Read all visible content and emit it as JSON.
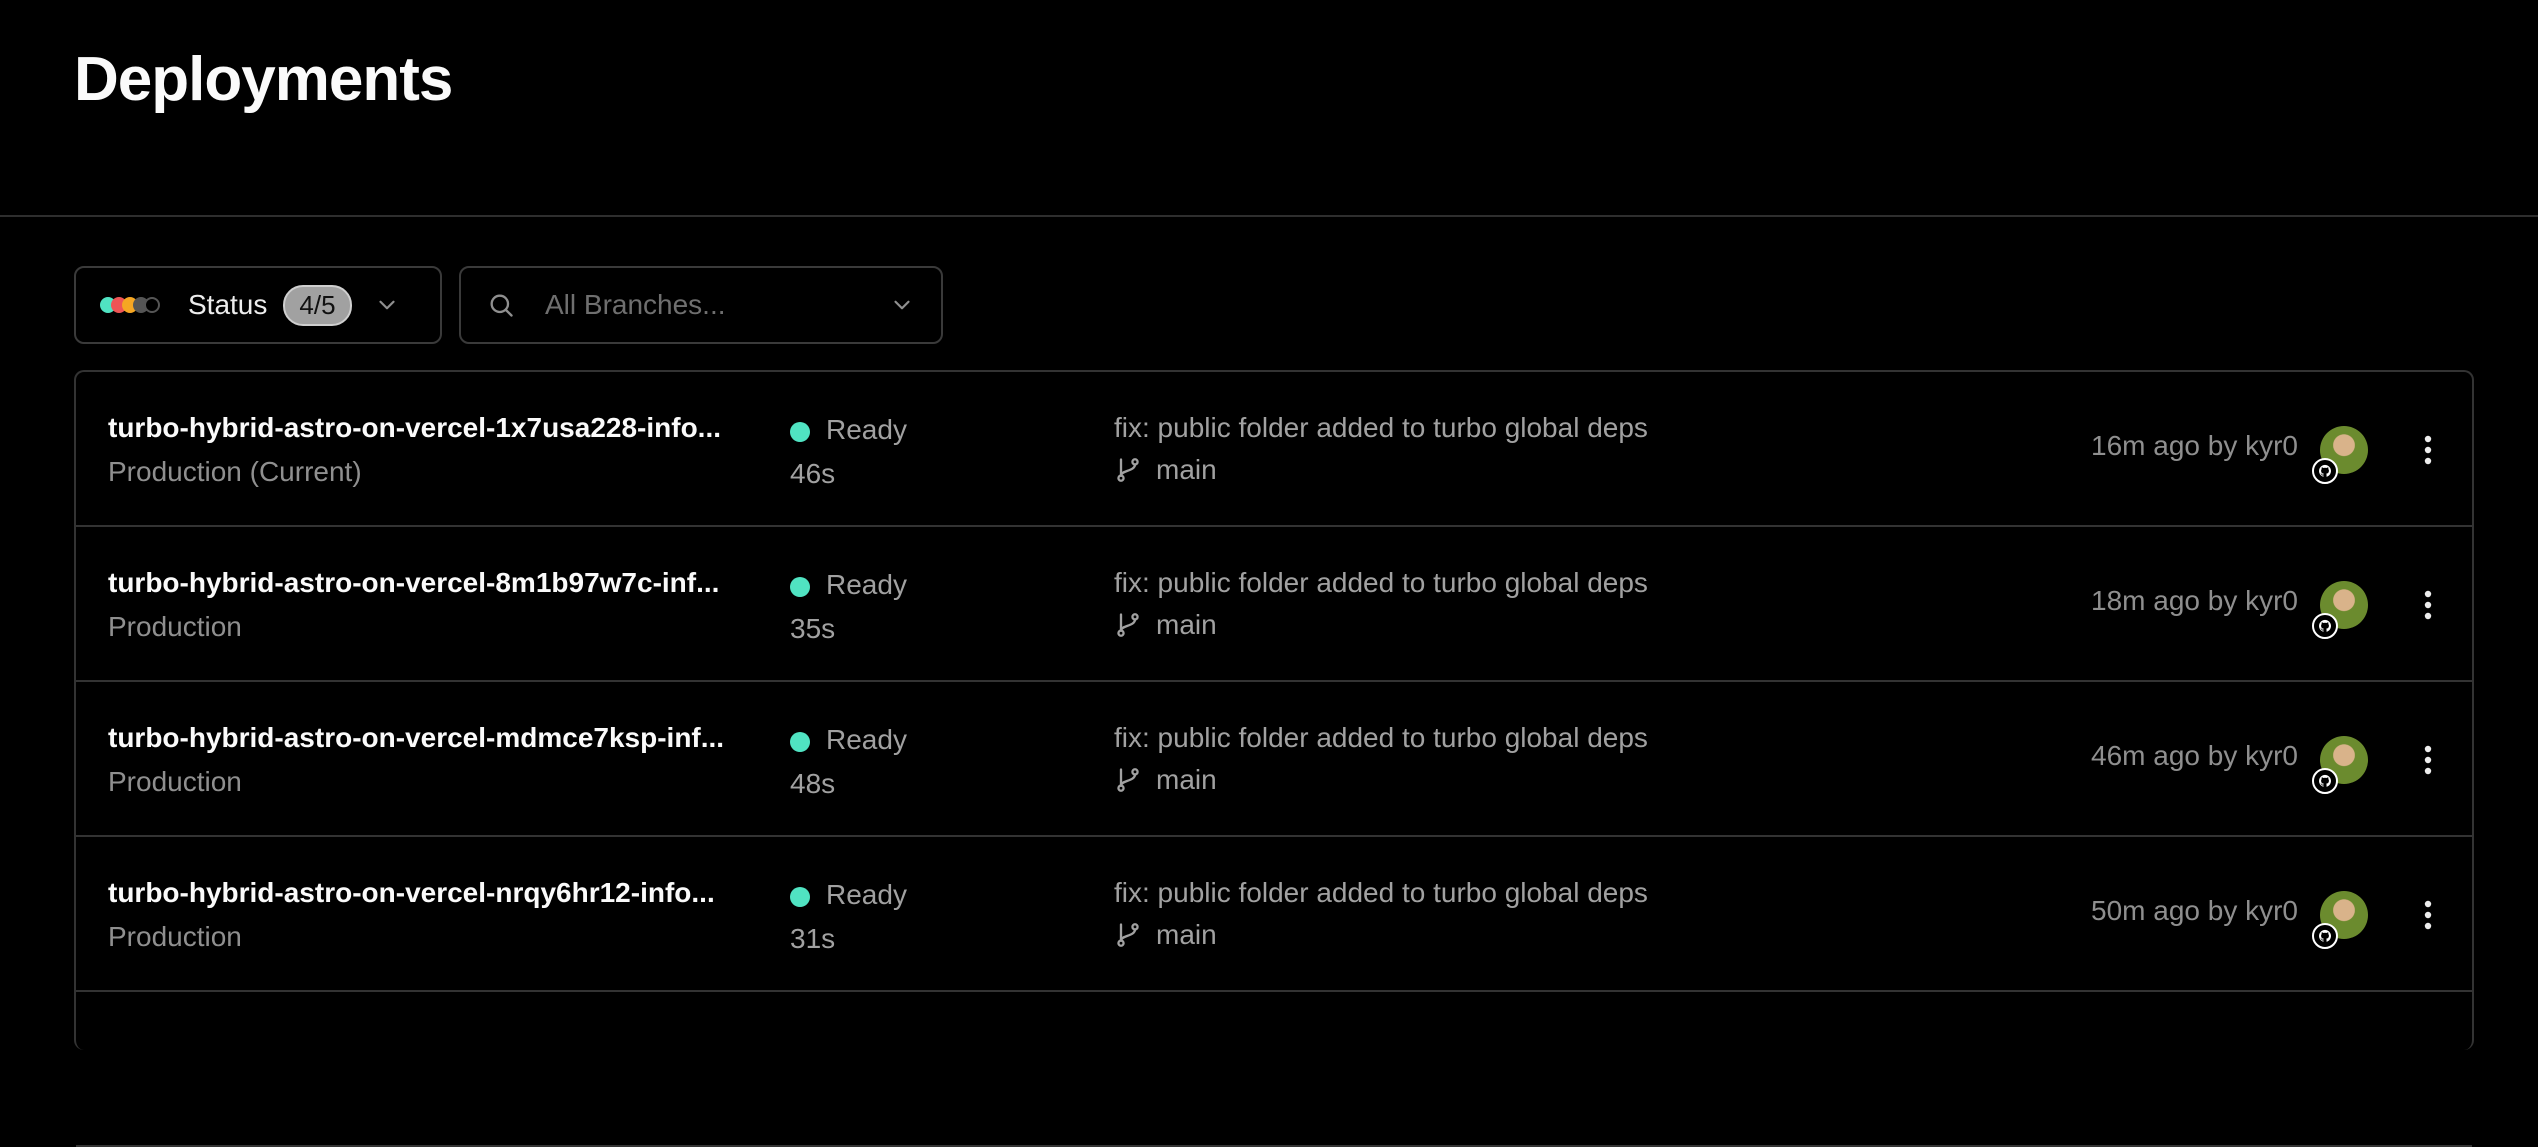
{
  "page": {
    "title": "Deployments"
  },
  "filters": {
    "status_label": "Status",
    "status_count": "4/5",
    "status_dot_colors": [
      "#50e3c2",
      "#ee5555",
      "#f5a623",
      "#555555",
      "transparent"
    ],
    "branch_placeholder": "All Branches..."
  },
  "colors": {
    "ready": "#50e3c2",
    "background": "#000000",
    "border": "#333333"
  },
  "deployments": [
    {
      "name": "turbo-hybrid-astro-on-vercel-1x7usa228-info...",
      "environment": "Production (Current)",
      "status": "Ready",
      "duration": "46s",
      "commit": "fix: public folder added to turbo global deps",
      "branch": "main",
      "time": "16m ago by kyr0"
    },
    {
      "name": "turbo-hybrid-astro-on-vercel-8m1b97w7c-inf...",
      "environment": "Production",
      "status": "Ready",
      "duration": "35s",
      "commit": "fix: public folder added to turbo global deps",
      "branch": "main",
      "time": "18m ago by kyr0"
    },
    {
      "name": "turbo-hybrid-astro-on-vercel-mdmce7ksp-inf...",
      "environment": "Production",
      "status": "Ready",
      "duration": "48s",
      "commit": "fix: public folder added to turbo global deps",
      "branch": "main",
      "time": "46m ago by kyr0"
    },
    {
      "name": "turbo-hybrid-astro-on-vercel-nrqy6hr12-info...",
      "environment": "Production",
      "status": "Ready",
      "duration": "31s",
      "commit": "fix: public folder added to turbo global deps",
      "branch": "main",
      "time": "50m ago by kyr0"
    }
  ],
  "icons": {
    "search": "search-icon",
    "chevron": "chevron-down-icon",
    "branch": "git-branch-icon",
    "github": "github-icon",
    "more": "more-vertical-icon"
  }
}
